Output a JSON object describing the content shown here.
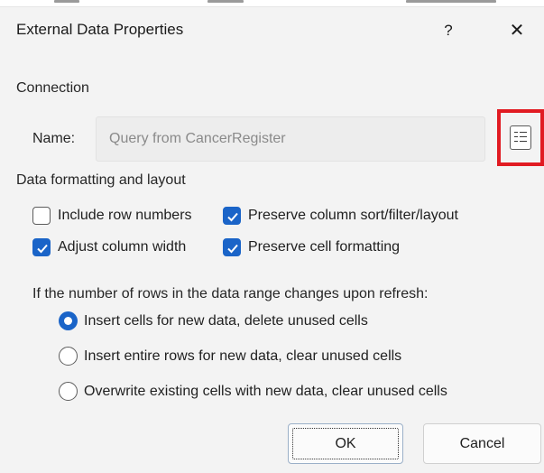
{
  "dialog": {
    "title": "External Data Properties",
    "help_label": "?",
    "close_label": "✕"
  },
  "connection": {
    "section_label": "Connection",
    "name_label": "Name:",
    "name_value": "Query from CancerRegister",
    "properties_icon": "connection-properties-icon"
  },
  "formatting": {
    "section_label": "Data formatting and layout",
    "options": [
      {
        "label": "Include row numbers",
        "checked": false
      },
      {
        "label": "Preserve column sort/filter/layout",
        "checked": true
      },
      {
        "label": "Adjust column width",
        "checked": true
      },
      {
        "label": "Preserve cell formatting",
        "checked": true
      }
    ]
  },
  "refresh": {
    "prompt": "If the number of rows in the data range changes upon refresh:",
    "options": [
      {
        "label": "Insert cells for new data, delete unused cells",
        "selected": true
      },
      {
        "label": "Insert entire rows for new data, clear unused cells",
        "selected": false
      },
      {
        "label": "Overwrite existing cells with new data, clear unused cells",
        "selected": false
      }
    ]
  },
  "buttons": {
    "ok": "OK",
    "cancel": "Cancel"
  },
  "colors": {
    "accent": "#1a64c8",
    "highlight_box": "#e11b22",
    "dialog_bg": "#f3f3f3"
  }
}
